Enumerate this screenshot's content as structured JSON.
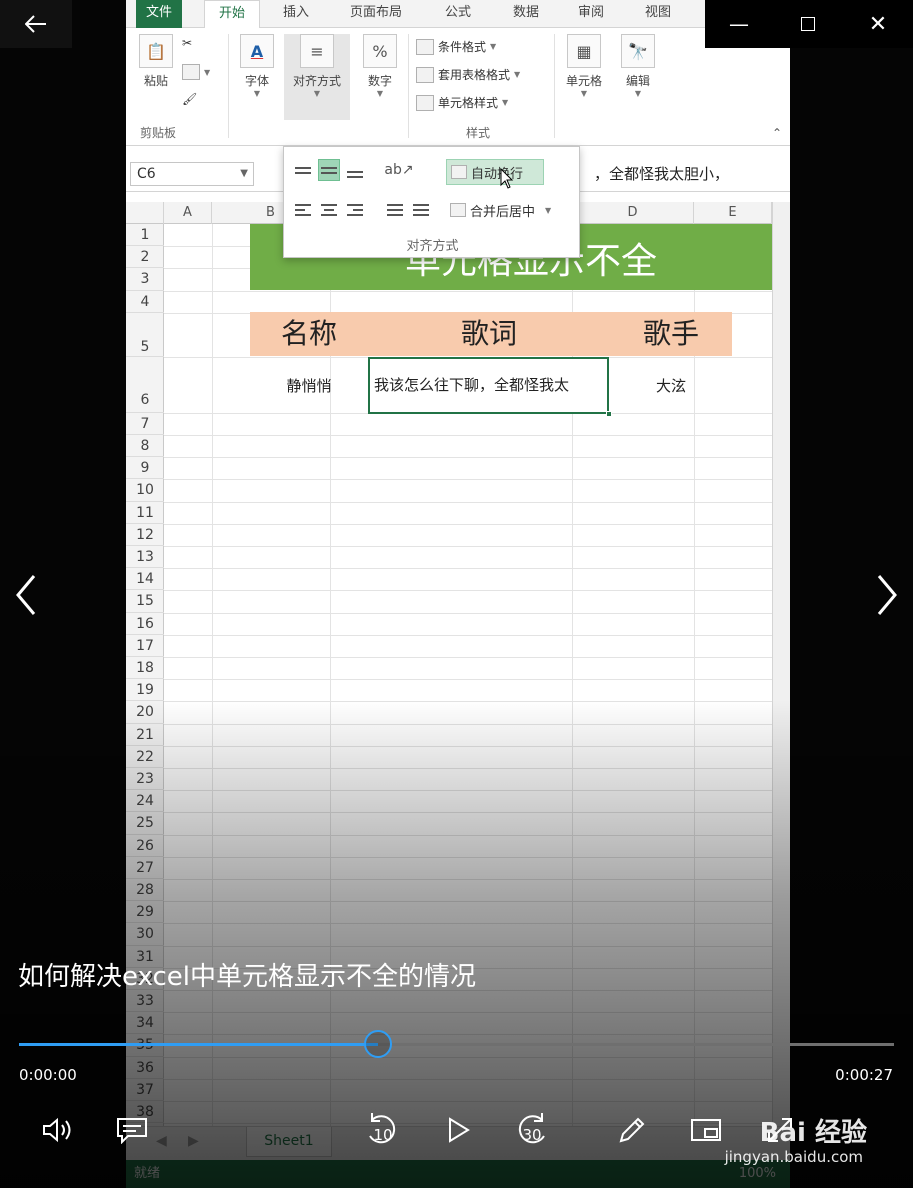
{
  "window": {
    "back_icon": "arrow-left-icon",
    "min_label": "—",
    "close_label": "✕"
  },
  "ribbon": {
    "tabs": [
      "文件",
      "开始",
      "插入",
      "页面布局",
      "公式",
      "数据",
      "审阅",
      "视图"
    ],
    "active_tab": "开始",
    "clipboard": {
      "paste": "粘贴",
      "group": "剪贴板"
    },
    "font": {
      "label": "字体",
      "icon_text": "A"
    },
    "alignment": {
      "label": "对齐方式"
    },
    "number": {
      "label": "数字",
      "icon_text": "%"
    },
    "styles": {
      "conditional": "条件格式",
      "table_format": "套用表格格式",
      "cell_styles": "单元格样式",
      "group": "样式"
    },
    "cells": {
      "label": "单元格"
    },
    "edit": {
      "label": "编辑"
    }
  },
  "formula_bar": {
    "name_box": "C6",
    "content": "，全都怪我太胆小，"
  },
  "align_panel": {
    "wrap_text": "自动换行",
    "merge_center": "合并后居中",
    "group_label": "对齐方式"
  },
  "sheet": {
    "columns": [
      "A",
      "B",
      "C",
      "D",
      "E"
    ],
    "rows": [
      "1",
      "2",
      "3",
      "4",
      "5",
      "6",
      "7",
      "8",
      "9",
      "10",
      "11",
      "12",
      "13",
      "14",
      "15",
      "16",
      "17",
      "18",
      "19",
      "20",
      "21",
      "22",
      "23",
      "24",
      "25",
      "26",
      "27",
      "28",
      "29",
      "30",
      "31",
      "32",
      "33",
      "34",
      "35",
      "36",
      "37",
      "38"
    ],
    "title": "单元格显示不全",
    "headers": {
      "name": "名称",
      "lyrics": "歌词",
      "singer": "歌手"
    },
    "row6": {
      "name": "静悄悄",
      "lyrics": "我该怎么往下聊，全都怪我太",
      "singer": "大泫"
    },
    "tab": "Sheet1",
    "status": "就绪",
    "zoom": "100%"
  },
  "player": {
    "title": "如何解决excel中单元格显示不全的情况",
    "current_time": "0:00:00",
    "total_time": "0:00:27",
    "progress": 0.41,
    "skip_back": "10",
    "skip_forward": "30",
    "accent": "#2f9df4"
  },
  "watermark": {
    "brand": "Bai 经验",
    "url": "jingyan.baidu.com"
  },
  "colors": {
    "excel_green": "#217346",
    "title_fill": "#70ad47",
    "header_fill": "#f8cbad"
  }
}
